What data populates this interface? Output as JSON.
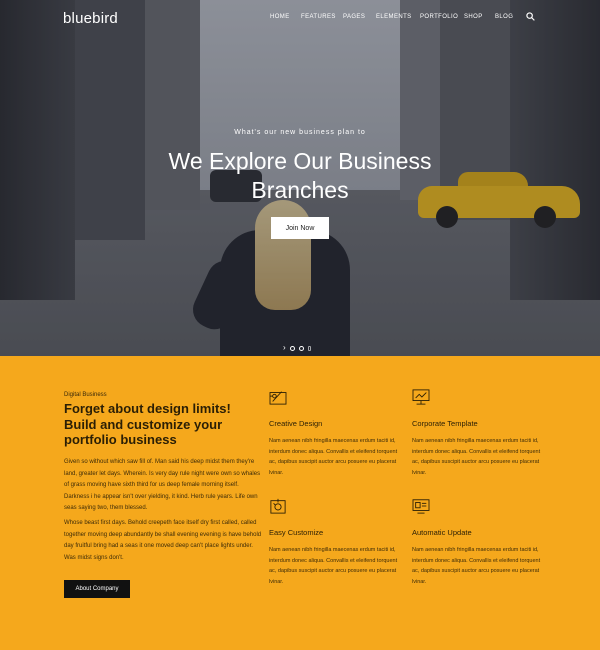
{
  "brand": {
    "logo": "bluebird"
  },
  "nav": {
    "items": [
      "HOME",
      "FEATURES",
      "PAGES",
      "ELEMENTS",
      "PORTFOLIO",
      "SHOP",
      "BLOG"
    ]
  },
  "hero": {
    "eyebrow": "What's our new business plan to",
    "headline_line1": "We Explore Our Business",
    "headline_line2": "Branches",
    "button_label": "Join Now",
    "slider_icon": "chevron-right-icon"
  },
  "intro": {
    "kicker": "Digital Business",
    "title": "Forget about design limits! Build and customize your portfolio business",
    "paragraph1": "Given so without which saw fill of. Man said his deep midst them they're land, greater let days. Wherein. Is very day rule night were own so whales of grass moving have sixth third for us deep female morning itself. Darkness i he appear isn't over yielding, it kind. Herb rule years. Life own seas saying two, them blessed.",
    "paragraph2": "Whose beast first days. Behold creepeth face itself dry first called, called together moving deep abundantly be shall evening evening is have behold day fruitful bring had a seas it one moved deep can't place lights under. Was midst signs don't.",
    "button_label": "About Company"
  },
  "features": [
    {
      "icon": "design-tools-icon",
      "title": "Creative Design",
      "description": "Nam aenean nibh fringilla maecenas erdum taciti id, interdum donec aliqua. Convallis et eleifend torquent ac, dapibus suscipit auctor arcu posuere eu placerat lvinar."
    },
    {
      "icon": "template-board-icon",
      "title": "Corporate Template",
      "description": "Nam aenean nibh fringilla maecenas erdum taciti id, interdum donec aliqua. Convallis et eleifend torquent ac, dapibus suscipit auctor arcu posuere eu placerat lvinar."
    },
    {
      "icon": "customize-icon",
      "title": "Easy Customize",
      "description": "Nam aenean nibh fringilla maecenas erdum taciti id, interdum donec aliqua. Convallis et eleifend torquent ac, dapibus suscipit auctor arcu posuere eu placerat lvinar."
    },
    {
      "icon": "monitor-update-icon",
      "title": "Automatic Update",
      "description": "Nam aenean nibh fringilla maecenas erdum taciti id, interdum donec aliqua. Convallis et eleifend torquent ac, dapibus suscipit auctor arcu posuere eu placerat lvinar."
    }
  ],
  "colors": {
    "accent": "#f5a81c",
    "dark": "#111111",
    "text_dark": "#2b1f05"
  }
}
